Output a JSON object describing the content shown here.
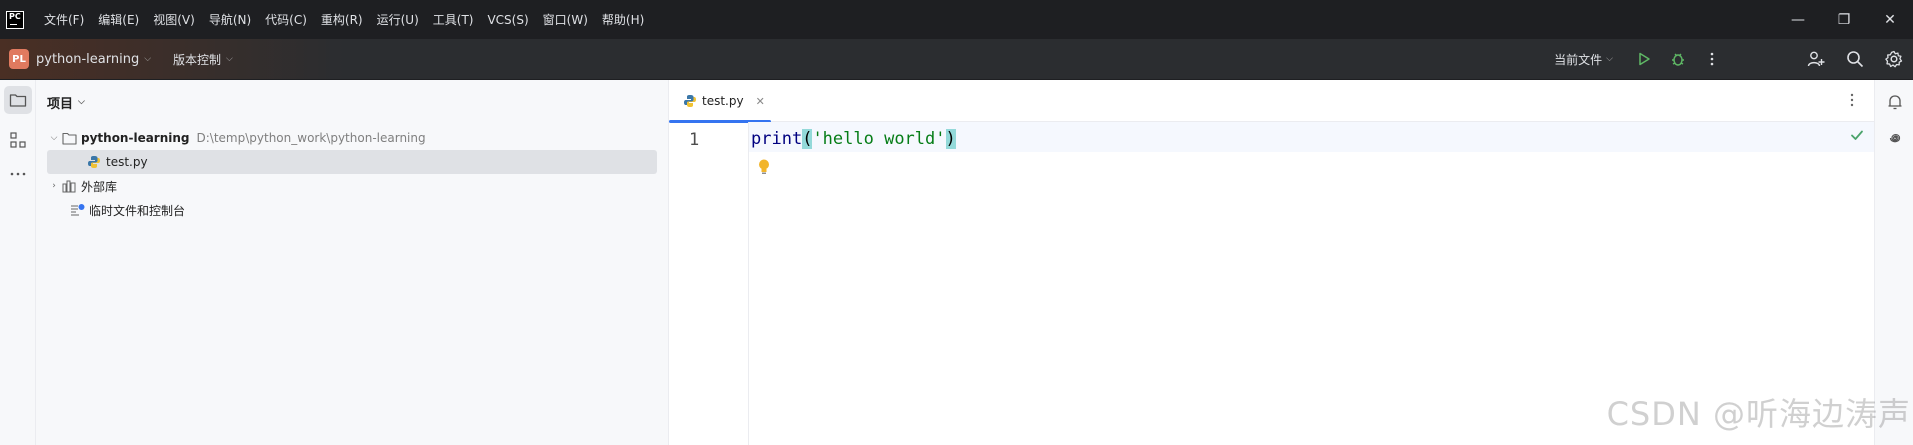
{
  "titlebar": {
    "logo_text": "PC",
    "menu": [
      "文件(F)",
      "编辑(E)",
      "视图(V)",
      "导航(N)",
      "代码(C)",
      "重构(R)",
      "运行(U)",
      "工具(T)",
      "VCS(S)",
      "窗口(W)",
      "帮助(H)"
    ],
    "minimize": "—",
    "restore": "❐",
    "close": "✕"
  },
  "toolbar": {
    "project_badge": "PL",
    "project_name": "python-learning",
    "vcs_label": "版本控制",
    "current_file": "当前文件"
  },
  "project_panel": {
    "title": "项目",
    "root_name": "python-learning",
    "root_path": "D:\\temp\\python_work\\python-learning",
    "file_name": "test.py",
    "external_libs": "外部库",
    "scratches": "临时文件和控制台"
  },
  "editor": {
    "tab_label": "test.py",
    "line_number": "1",
    "code": {
      "func": "print",
      "open": "(",
      "string": "'hello world'",
      "close": ")"
    }
  },
  "watermark": "CSDN @听海边涛声",
  "colors": {
    "accent": "#3574f0",
    "run_green": "#5fb865",
    "string_green": "#067d17",
    "keyword_navy": "#000080",
    "brace_highlight": "#93d9d9"
  }
}
